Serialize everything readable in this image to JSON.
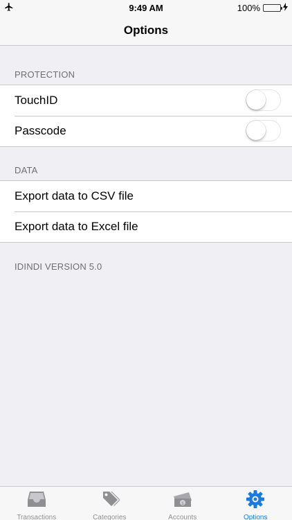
{
  "status_bar": {
    "time": "9:49 AM",
    "battery_percent": "100%",
    "battery_level": 1.0,
    "airplane_icon": "airplane-icon",
    "charging_icon": "bolt-icon"
  },
  "nav": {
    "title": "Options"
  },
  "sections": {
    "protection": {
      "header": "PROTECTION",
      "rows": [
        {
          "label": "TouchID",
          "toggle_on": false
        },
        {
          "label": "Passcode",
          "toggle_on": false
        }
      ]
    },
    "data": {
      "header": "DATA",
      "rows": [
        {
          "label": "Export data to CSV file"
        },
        {
          "label": "Export data to Excel file"
        }
      ]
    }
  },
  "version_text": "IDINDI VERSION 5.0",
  "tabbar": {
    "tabs": [
      {
        "label": "Transactions",
        "icon": "inbox-tray-icon",
        "active": false
      },
      {
        "label": "Categories",
        "icon": "tags-icon",
        "active": false
      },
      {
        "label": "Accounts",
        "icon": "money-icon",
        "active": false
      },
      {
        "label": "Options",
        "icon": "gear-icon",
        "active": true
      }
    ]
  },
  "colors": {
    "accent": "#1a7ae0",
    "inactive_tab": "#929292",
    "background": "#efeff4",
    "battery": "#4cd964"
  }
}
